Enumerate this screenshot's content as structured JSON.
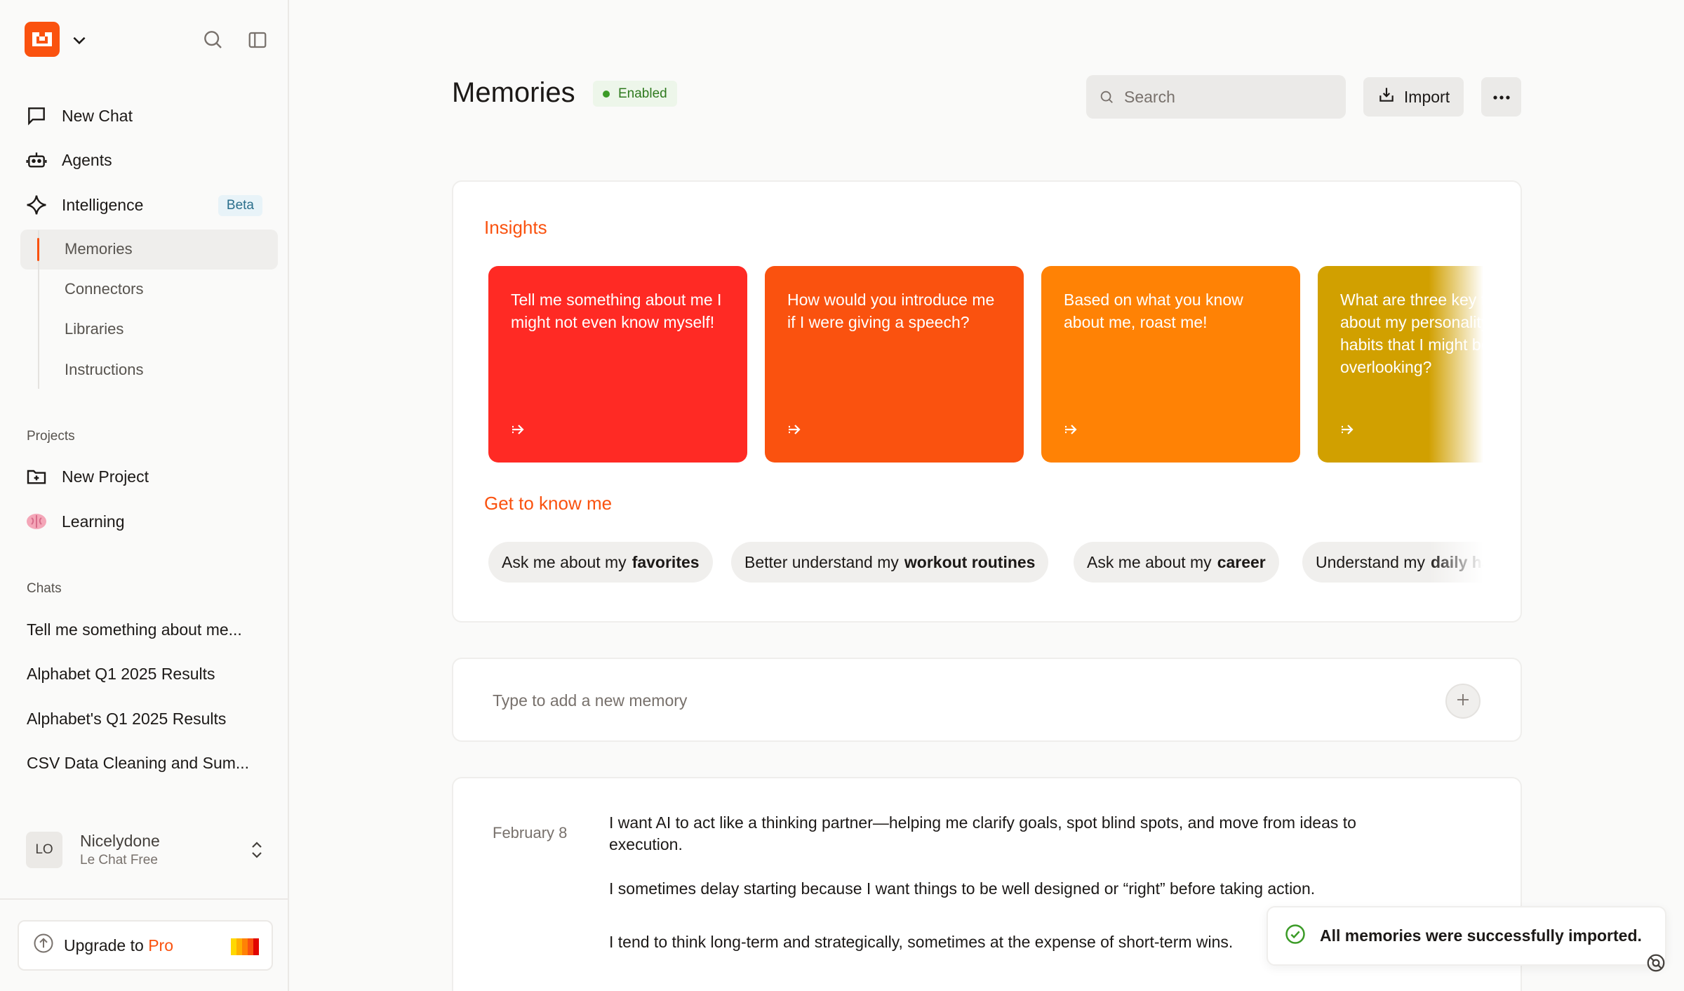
{
  "sidebar": {
    "logo_icon": "mistral-logo-icon",
    "nav": [
      {
        "label": "New Chat",
        "icon": "chat-bubble-icon"
      },
      {
        "label": "Agents",
        "icon": "robot-icon"
      },
      {
        "label": "Intelligence",
        "icon": "sparkle-icon",
        "badge": "Beta"
      }
    ],
    "sub_items": [
      "Memories",
      "Connectors",
      "Libraries",
      "Instructions"
    ],
    "active_sub": "Memories",
    "projects_label": "Projects",
    "projects": [
      {
        "label": "New Project",
        "icon": "folder-plus-icon"
      },
      {
        "label": "Learning",
        "icon": "brain-icon"
      }
    ],
    "chats_label": "Chats",
    "chats": [
      "Tell me something about me...",
      "Alphabet Q1 2025 Results",
      "Alphabet's Q1 2025 Results",
      "CSV Data Cleaning and Sum..."
    ],
    "user": {
      "initials": "LO",
      "name": "Nicelydone",
      "plan": "Le Chat Free"
    },
    "upgrade": {
      "prefix": "Upgrade to",
      "pro": "Pro"
    }
  },
  "header": {
    "title": "Memories",
    "status": "Enabled",
    "search_placeholder": "Search",
    "import_label": "Import"
  },
  "insights": {
    "heading": "Insights",
    "tiles": [
      {
        "text": "Tell me something about me I might not even know myself!",
        "color": "#ff2a24"
      },
      {
        "text": "How would you introduce me if I were giving a speech?",
        "color": "#fa520f"
      },
      {
        "text": "Based on what you know about me, roast me!",
        "color": "#ff8205"
      },
      {
        "text": "What are three key traits about my personality or habits that I might be overlooking?",
        "color": "#d1a000"
      }
    ]
  },
  "get_to_know": {
    "heading": "Get to know me",
    "chips": [
      {
        "prefix": "Ask me about my",
        "topic": "favorites"
      },
      {
        "prefix": "Better understand my",
        "topic": "workout routines"
      },
      {
        "prefix": "Ask me about my",
        "topic": "career"
      },
      {
        "prefix": "Understand my",
        "topic": "daily habits"
      }
    ]
  },
  "new_memory": {
    "placeholder": "Type to add a new memory"
  },
  "memories": {
    "date": "February 8",
    "items": [
      "I want AI to act like a thinking partner—helping me clarify goals, spot blind spots, and move from ideas to execution.",
      "I sometimes delay starting because I want things to be well designed or “right” before taking action.",
      "I tend to think long-term and strategically, sometimes at the expense of short-term wins."
    ]
  },
  "toast": {
    "message": "All memories were successfully imported."
  },
  "colors": {
    "accent": "#fa520f",
    "success": "#3b9b27"
  }
}
